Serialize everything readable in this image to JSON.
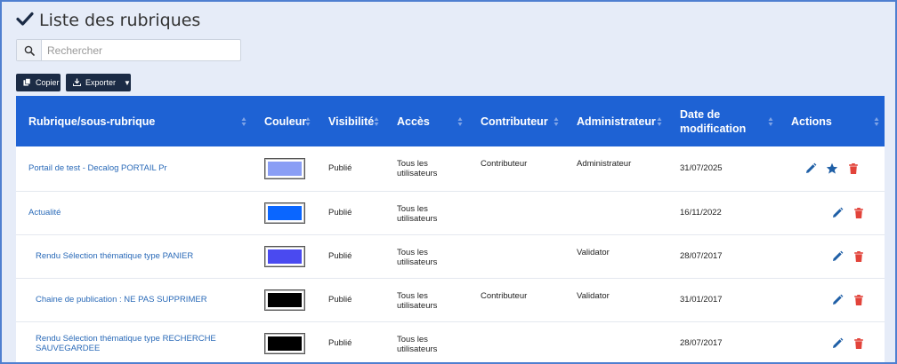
{
  "page": {
    "title": "Liste des rubriques"
  },
  "search": {
    "placeholder": "Rechercher",
    "value": ""
  },
  "toolbar": {
    "copy_label": "Copier",
    "export_label": "Exporter"
  },
  "table": {
    "headers": [
      "Rubrique/sous-rubrique",
      "Couleur",
      "Visibilité",
      "Accès",
      "Contributeur",
      "Administrateur",
      "Date de modification",
      "Actions"
    ],
    "rows": [
      {
        "name": "Portail de test - Decalog PORTAIL Pr",
        "color": "#8a9ef5",
        "visibility": "Publié",
        "access": "Tous les utilisateurs",
        "contributor": "Contributeur",
        "administrator": "Administrateur",
        "date": "31/07/2025",
        "actions": [
          "edit",
          "favorite",
          "delete"
        ]
      },
      {
        "name": "Actualité",
        "color": "#0a66ff",
        "visibility": "Publié",
        "access": "Tous les utilisateurs",
        "contributor": "",
        "administrator": "",
        "date": "16/11/2022",
        "actions": [
          "edit",
          "delete"
        ]
      },
      {
        "name": "Rendu Sélection thématique type PANIER",
        "color": "#4a4af0",
        "visibility": "Publié",
        "access": "Tous les utilisateurs",
        "contributor": "",
        "administrator": "Validator",
        "date": "28/07/2017",
        "actions": [
          "edit",
          "delete"
        ]
      },
      {
        "name": "Chaine de publication : NE PAS SUPPRIMER",
        "color": "#000000",
        "visibility": "Publié",
        "access": "Tous les utilisateurs",
        "contributor": "Contributeur",
        "administrator": "Validator",
        "date": "31/01/2017",
        "actions": [
          "edit",
          "delete"
        ]
      },
      {
        "name": "Rendu Sélection thématique type RECHERCHE SAUVEGARDEE",
        "color": "#000000",
        "visibility": "Publié",
        "access": "Tous les utilisateurs",
        "contributor": "",
        "administrator": "",
        "date": "28/07/2017",
        "actions": [
          "edit",
          "delete"
        ]
      }
    ]
  },
  "colors": {
    "accent": "#1e62d4",
    "dark_button": "#1b2b45",
    "link": "#2a6ab8",
    "edit_icon": "#1f5fa6",
    "delete_icon": "#e2433a"
  }
}
